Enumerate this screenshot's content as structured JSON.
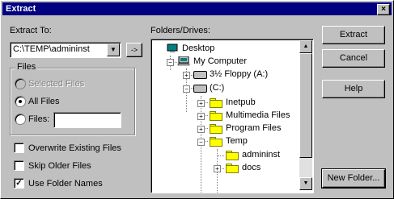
{
  "title": "Extract",
  "close_glyph": "×",
  "extract_to": {
    "label": "Extract To:",
    "value": "C:\\TEMP\\admininst",
    "browse_glyph": "->"
  },
  "files_group": {
    "label": "Files",
    "selected_files": "Selected Files",
    "all_files": "All Files",
    "files": "Files:",
    "files_value": ""
  },
  "options": {
    "overwrite": "Overwrite Existing Files",
    "overwrite_checked": false,
    "skip_older": "Skip Older Files",
    "skip_older_checked": false,
    "use_folder_names": "Use Folder Names",
    "use_folder_names_checked": true,
    "check_glyph": "✓"
  },
  "folders": {
    "label": "Folders/Drives:",
    "nodes": {
      "desktop": "Desktop",
      "my_computer": "My Computer",
      "floppy": "3½ Floppy (A:)",
      "c_drive": "(C:)",
      "inetpub": "Inetpub",
      "multimedia": "Multimedia Files",
      "program_files": "Program Files",
      "temp": "Temp",
      "admininst": "admininst",
      "docs": "docs"
    }
  },
  "buttons": {
    "extract": "Extract",
    "cancel": "Cancel",
    "help": "Help",
    "new_folder": "New Folder..."
  }
}
